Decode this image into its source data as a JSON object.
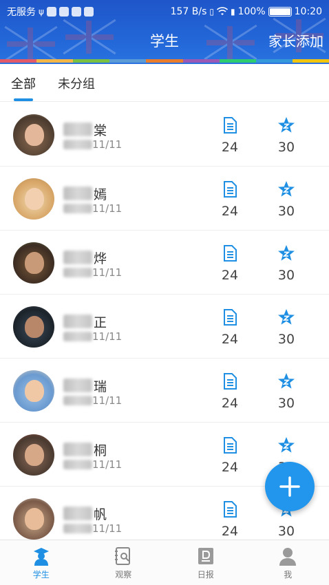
{
  "status_bar": {
    "carrier": "无服务",
    "speed": "157 B/s",
    "battery": "100%",
    "time": "10:20"
  },
  "header": {
    "title": "学生",
    "action": "家长添加"
  },
  "colors": {
    "primary": "#1e8fe3",
    "header_bg": "#2266d8",
    "rainbow": [
      "#e05a6a",
      "#f1b548",
      "#7ac143",
      "#5b9bd5",
      "#e87d2e",
      "#9b59b6",
      "#2ecc71",
      "#3498db",
      "#f1c40f"
    ]
  },
  "tabs": [
    {
      "label": "全部",
      "active": true
    },
    {
      "label": "未分组",
      "active": false
    }
  ],
  "students": [
    {
      "name_visible": "棠",
      "date_visible": "11/11",
      "docs": "24",
      "stars": "30"
    },
    {
      "name_visible": "嫣",
      "date_visible": "11/11",
      "docs": "24",
      "stars": "30"
    },
    {
      "name_visible": "烨",
      "date_visible": "11/11",
      "docs": "24",
      "stars": "30"
    },
    {
      "name_visible": "正",
      "date_visible": "11/11",
      "docs": "24",
      "stars": "30"
    },
    {
      "name_visible": "瑞",
      "date_visible": "11/11",
      "docs": "24",
      "stars": "30"
    },
    {
      "name_visible": "桐",
      "date_visible": "11/11",
      "docs": "24",
      "stars": "30"
    },
    {
      "name_visible": "帆",
      "date_visible": "11/11",
      "docs": "24",
      "stars": "30"
    }
  ],
  "fab_icon": "plus-icon",
  "bottom_nav": [
    {
      "label": "学生",
      "icon": "student-cap-icon",
      "active": true
    },
    {
      "label": "观察",
      "icon": "observe-notebook-icon",
      "active": false
    },
    {
      "label": "日报",
      "icon": "daily-report-icon",
      "active": false
    },
    {
      "label": "我",
      "icon": "profile-icon",
      "active": false
    }
  ]
}
